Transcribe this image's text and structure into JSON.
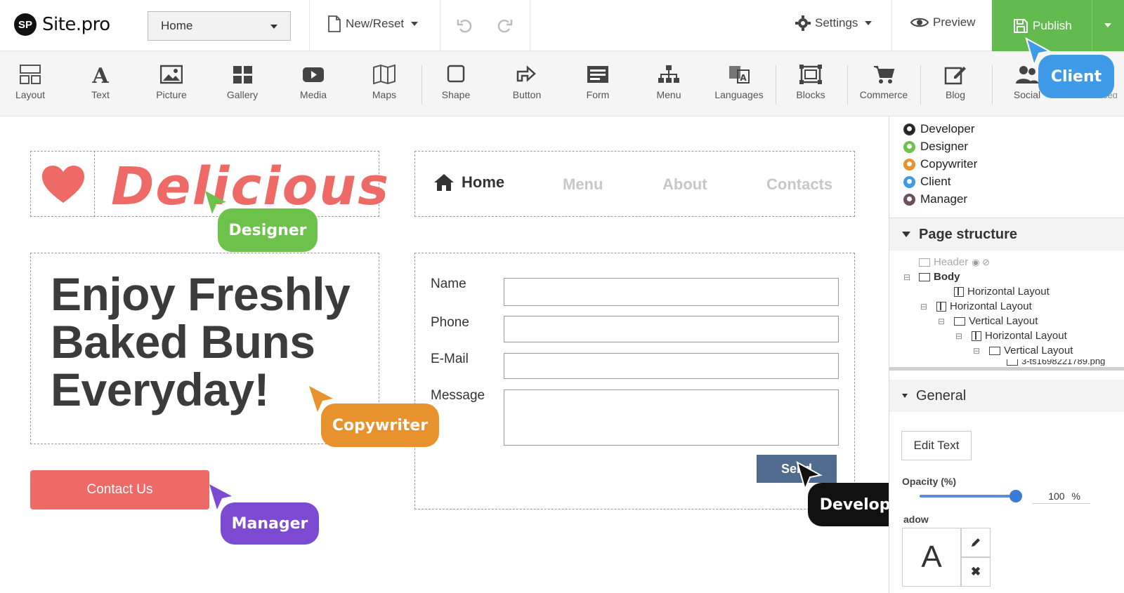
{
  "topbar": {
    "logo_badge": "SP",
    "logo_text": "Site.pro",
    "page_select": "Home",
    "new_reset": "New/Reset",
    "settings": "Settings",
    "preview": "Preview",
    "publish": "Publish"
  },
  "toolbar": {
    "items": [
      {
        "label": "Layout",
        "icon": "layout-icon"
      },
      {
        "label": "Text",
        "icon": "text-icon"
      },
      {
        "label": "Picture",
        "icon": "picture-icon"
      },
      {
        "label": "Gallery",
        "icon": "gallery-icon"
      },
      {
        "label": "Media",
        "icon": "media-icon"
      },
      {
        "label": "Maps",
        "icon": "maps-icon"
      },
      {
        "label": "Shape",
        "icon": "shape-icon"
      },
      {
        "label": "Button",
        "icon": "button-icon"
      },
      {
        "label": "Form",
        "icon": "form-icon"
      },
      {
        "label": "Menu",
        "icon": "menu-icon"
      },
      {
        "label": "Languages",
        "icon": "languages-icon"
      },
      {
        "label": "Blocks",
        "icon": "blocks-icon"
      },
      {
        "label": "Commerce",
        "icon": "commerce-icon"
      },
      {
        "label": "Blog",
        "icon": "blog-icon"
      },
      {
        "label": "Social",
        "icon": "social-icon"
      },
      {
        "label": "Advanced",
        "icon": "advanced-icon"
      }
    ]
  },
  "canvas": {
    "logo_word": "Delicious",
    "nav": {
      "home": "Home",
      "menu": "Menu",
      "about": "About",
      "contacts": "Contacts"
    },
    "headline": "Enjoy Freshly Baked Buns Everyday!",
    "cta": "Contact Us",
    "form": {
      "name": "Name",
      "phone": "Phone",
      "email": "E-Mail",
      "message": "Message",
      "send": "Send"
    }
  },
  "collaborators": {
    "designer": "Designer",
    "copywriter": "Copywriter",
    "manager": "Manager",
    "developer": "Developer",
    "client": "Client"
  },
  "colors": {
    "designer": "#6cc24a",
    "copywriter": "#e8922e",
    "manager": "#7c4bd1",
    "developer": "#111111",
    "client": "#3f9ae8",
    "brand_red": "#ee6a66",
    "publish_green": "#63bb4f"
  },
  "panel": {
    "roles": [
      "Developer",
      "Designer",
      "Copywriter",
      "Client",
      "Manager"
    ],
    "page_structure_title": "Page structure",
    "tree": {
      "header": "Header",
      "body": "Body",
      "h1": "Horizontal Layout",
      "h2": "Horizontal Layout",
      "v1": "Vertical Layout",
      "h3": "Horizontal Layout",
      "v2": "Vertical Layout",
      "img": "3-ts1698221789.png"
    },
    "general_title": "General",
    "edit_text": "Edit Text",
    "opacity_label": "Opacity (%)",
    "opacity_value": "100",
    "opacity_unit": "%",
    "opacity_level": 1.0,
    "shadow_label": "adow",
    "font_preview": "A"
  }
}
